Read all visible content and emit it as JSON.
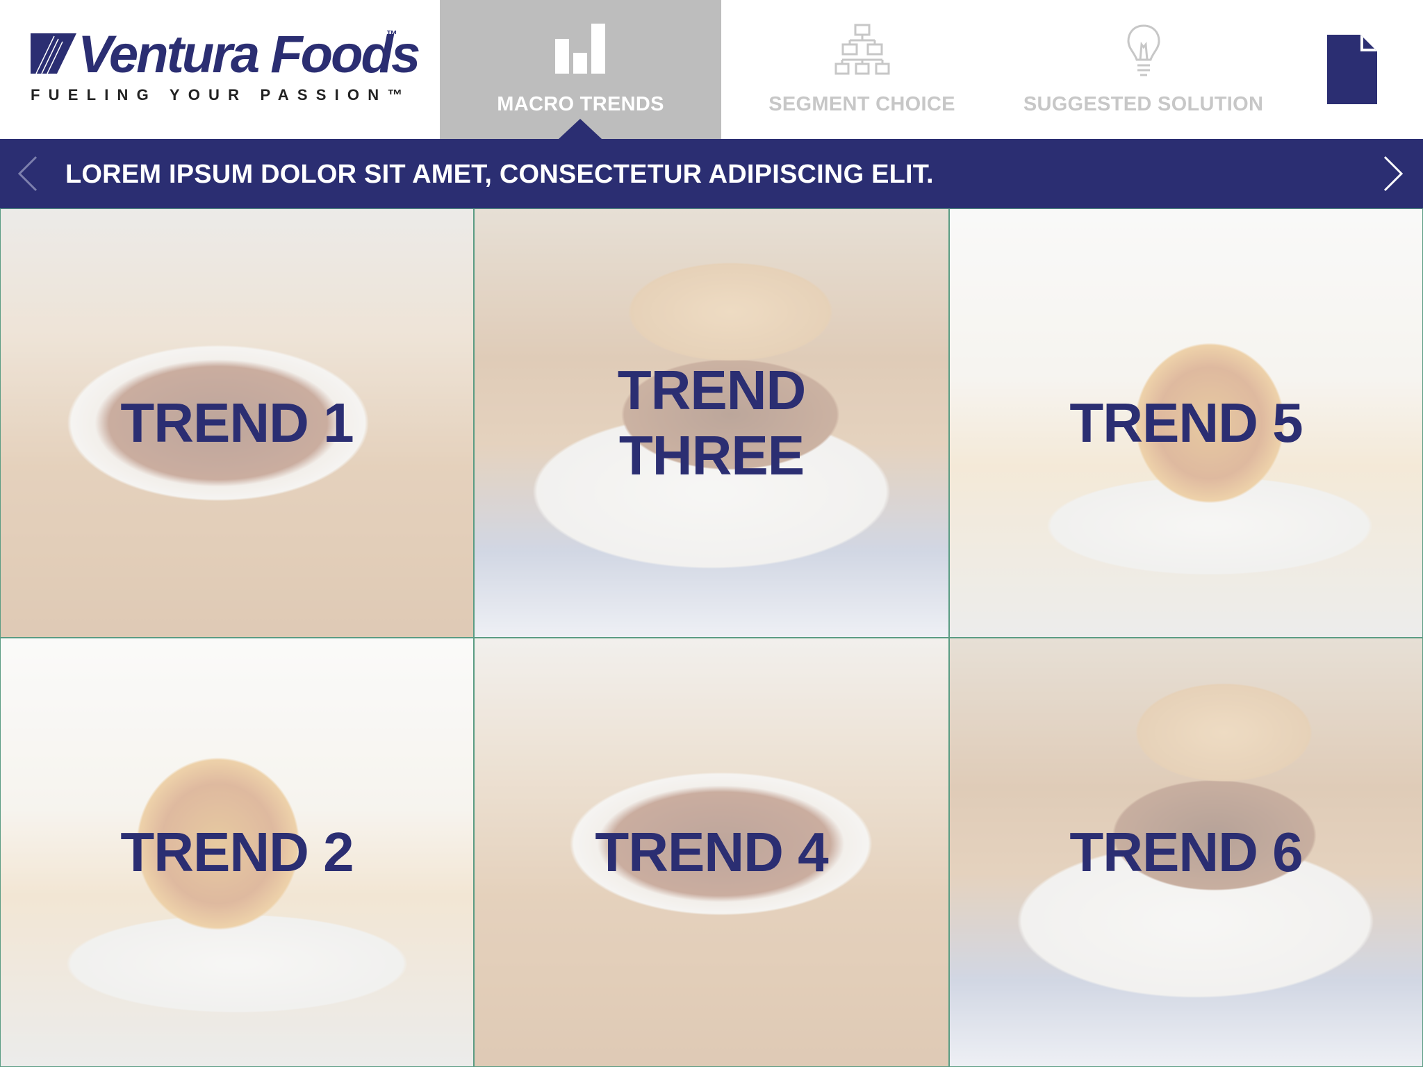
{
  "brand": {
    "name": "Ventura Foods",
    "trademark": "™",
    "tagline": "FUELING YOUR PASSION™",
    "color": "#2b2e72"
  },
  "nav": {
    "tabs": [
      {
        "label": "MACRO TRENDS",
        "icon": "bar-chart-icon",
        "active": true
      },
      {
        "label": "SEGMENT CHOICE",
        "icon": "org-chart-icon",
        "active": false
      },
      {
        "label": "SUGGESTED SOLUTION",
        "icon": "lightbulb-icon",
        "active": false
      }
    ],
    "doc_icon": "document-icon"
  },
  "banner": {
    "text": "LOREM IPSUM DOLOR SIT AMET, CONSECTETUR ADIPISCING ELIT.",
    "prev_icon": "chevron-left-icon",
    "next_icon": "chevron-right-icon"
  },
  "trends": [
    {
      "label": "TREND 1",
      "photo": "wings"
    },
    {
      "label": "TREND THREE",
      "photo": "burger"
    },
    {
      "label": "TREND 5",
      "photo": "stack"
    },
    {
      "label": "TREND 2",
      "photo": "stack"
    },
    {
      "label": "TREND 4",
      "photo": "wings"
    },
    {
      "label": "TREND 6",
      "photo": "burger"
    }
  ]
}
